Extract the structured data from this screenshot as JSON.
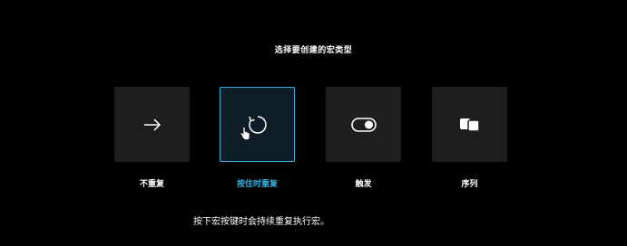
{
  "dialog": {
    "title": "选择要创建的宏类型",
    "description": "按下宏按键时会持续重复执行宏。"
  },
  "options": [
    {
      "label": "不重复",
      "icon": "arrow-right-icon",
      "selected": false
    },
    {
      "label": "按住时重复",
      "icon": "repeat-circle-icon",
      "selected": true
    },
    {
      "label": "触发",
      "icon": "toggle-icon",
      "selected": false
    },
    {
      "label": "序列",
      "icon": "sequence-icon",
      "selected": false
    }
  ],
  "colors": {
    "background": "#000000",
    "card": "#1e1e1e",
    "card_selected": "#0e1e26",
    "accent": "#3ab0e0",
    "text": "#ffffff"
  }
}
